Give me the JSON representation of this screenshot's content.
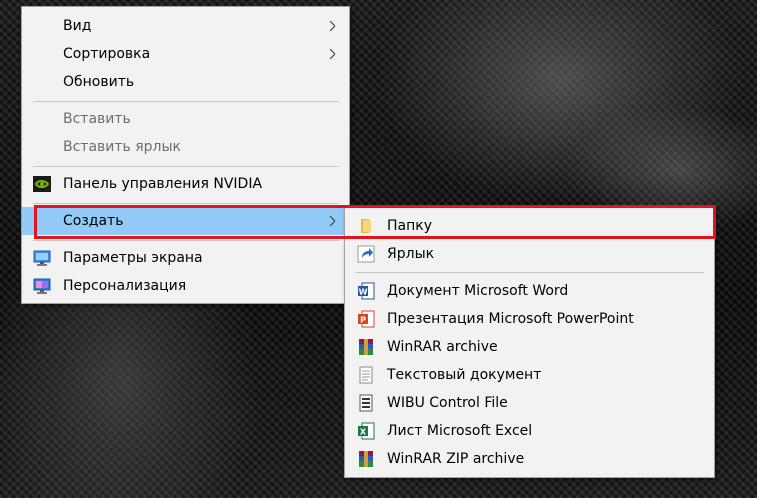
{
  "main_menu": {
    "items": [
      {
        "label": "Вид"
      },
      {
        "label": "Сортировка"
      },
      {
        "label": "Обновить"
      },
      {
        "label": "Вставить"
      },
      {
        "label": "Вставить ярлык"
      },
      {
        "label": "Панель управления NVIDIA"
      },
      {
        "label": "Создать"
      },
      {
        "label": "Параметры экрана"
      },
      {
        "label": "Персонализация"
      }
    ]
  },
  "sub_menu": {
    "items": [
      {
        "label": "Папку"
      },
      {
        "label": "Ярлык"
      },
      {
        "label": "Документ Microsoft Word"
      },
      {
        "label": "Презентация Microsoft PowerPoint"
      },
      {
        "label": "WinRAR archive"
      },
      {
        "label": "Текстовый документ"
      },
      {
        "label": "WIBU Control File"
      },
      {
        "label": "Лист Microsoft Excel"
      },
      {
        "label": "WinRAR ZIP archive"
      }
    ]
  },
  "colors": {
    "menu_background": "#f2f2f2",
    "hover_background": "#91c9f7",
    "disabled_text": "#6d6d6d",
    "highlight_border": "#e2141d",
    "nvidia_green": "#76b900",
    "word_blue": "#2b579a",
    "powerpoint_orange": "#d24726",
    "excel_green": "#217346"
  },
  "icons": {
    "nvidia": "nvidia-icon",
    "display_settings": "display-settings-icon",
    "personalization": "personalization-icon",
    "folder": "folder-icon",
    "shortcut": "shortcut-icon",
    "word": "word-document-icon",
    "powerpoint": "powerpoint-icon",
    "winrar": "winrar-icon",
    "text_document": "text-document-icon",
    "wibu": "wibu-file-icon",
    "excel": "excel-icon",
    "winrar_zip": "winrar-zip-icon"
  }
}
